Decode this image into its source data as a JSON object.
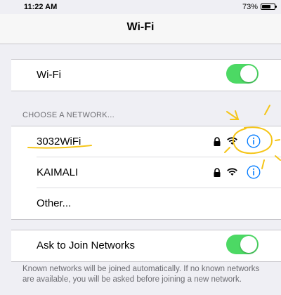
{
  "status_bar": {
    "time": "11:22 AM",
    "battery_percent": "73%",
    "battery_level": 0.73
  },
  "nav": {
    "title": "Wi-Fi"
  },
  "wifi": {
    "label": "Wi-Fi",
    "enabled": true
  },
  "networks": {
    "header": "CHOOSE A NETWORK...",
    "items": [
      {
        "name": "3032WiFi",
        "secured": true,
        "icons": [
          "lock-icon",
          "wifi-icon",
          "info-icon"
        ]
      },
      {
        "name": "KAIMALI",
        "secured": true,
        "icons": [
          "lock-icon",
          "wifi-icon",
          "info-icon"
        ]
      }
    ],
    "other_label": "Other..."
  },
  "ask_to_join": {
    "label": "Ask to Join Networks",
    "enabled": true,
    "note": "Known networks will be joined automatically. If no known networks are available, you will be asked before joining a new network."
  },
  "colors": {
    "toggle_on": "#4cd964",
    "accent": "#007aff",
    "highlight_annotation": "#f5c518"
  }
}
